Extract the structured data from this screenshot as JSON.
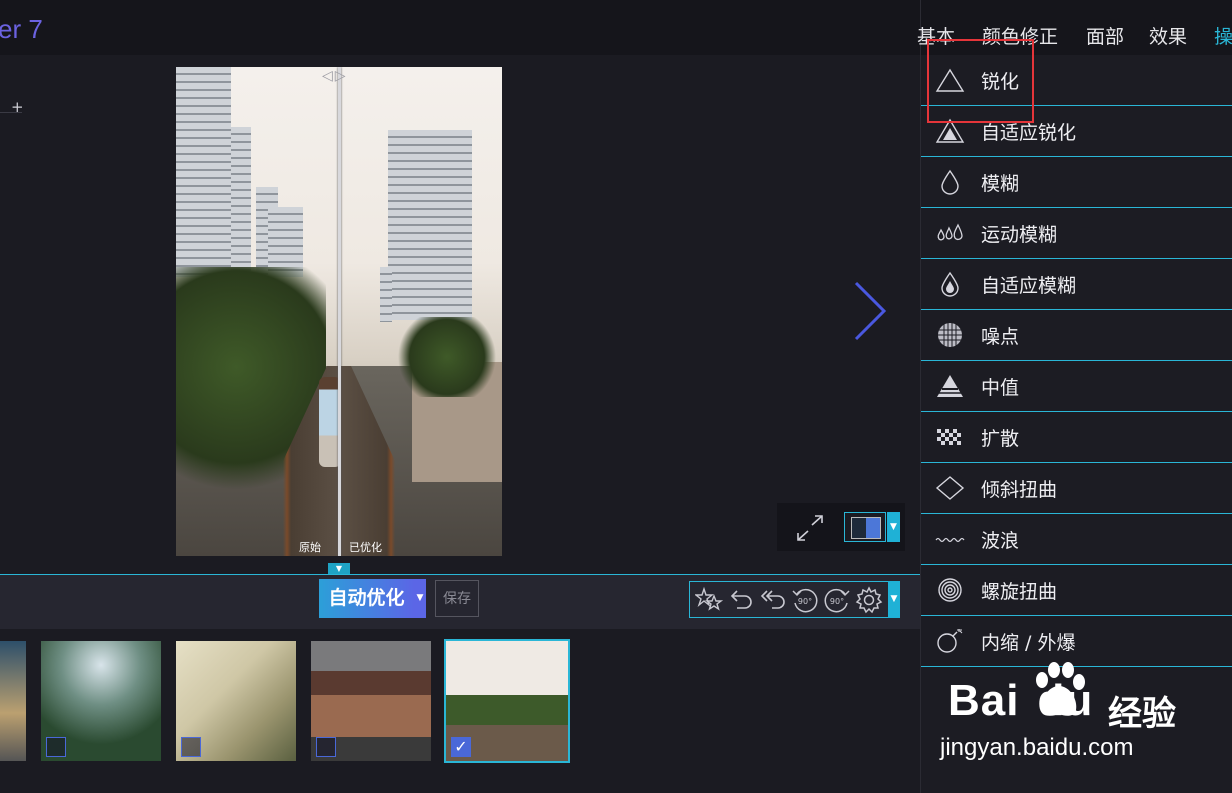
{
  "app": {
    "title": "er 7"
  },
  "image": {
    "label_original": "原始",
    "label_optimized": "已优化"
  },
  "toolbar": {
    "auto_label": "自动优化",
    "save_label": "保存",
    "rotate_label": "90°"
  },
  "tabs": [
    {
      "label": "基本"
    },
    {
      "label": "颜色修正"
    },
    {
      "label": "面部"
    },
    {
      "label": "效果"
    },
    {
      "label": "操"
    }
  ],
  "operations": [
    {
      "label": "锐化",
      "icon": "triangle-outline-icon"
    },
    {
      "label": "自适应锐化",
      "icon": "triangle-filled-icon"
    },
    {
      "label": "模糊",
      "icon": "drop-icon"
    },
    {
      "label": "运动模糊",
      "icon": "motion-drops-icon"
    },
    {
      "label": "自适应模糊",
      "icon": "drop-filled-icon"
    },
    {
      "label": "噪点",
      "icon": "noise-sphere-icon"
    },
    {
      "label": "中值",
      "icon": "median-pyramid-icon"
    },
    {
      "label": "扩散",
      "icon": "diffuse-checker-icon"
    },
    {
      "label": "倾斜扭曲",
      "icon": "diamond-icon"
    },
    {
      "label": "波浪",
      "icon": "wave-icon"
    },
    {
      "label": "螺旋扭曲",
      "icon": "spiral-icon"
    },
    {
      "label": "内缩 / 外爆",
      "icon": "bomb-icon"
    }
  ],
  "watermark": {
    "brand": "Bai",
    "brand2": "du",
    "cn": "经验",
    "url": "jingyan.baidu.com"
  },
  "colors": {
    "accent": "#2ab6d6",
    "highlight": "#e5353a",
    "auto_start": "#2c9fd8",
    "auto_end": "#5b66e6"
  }
}
